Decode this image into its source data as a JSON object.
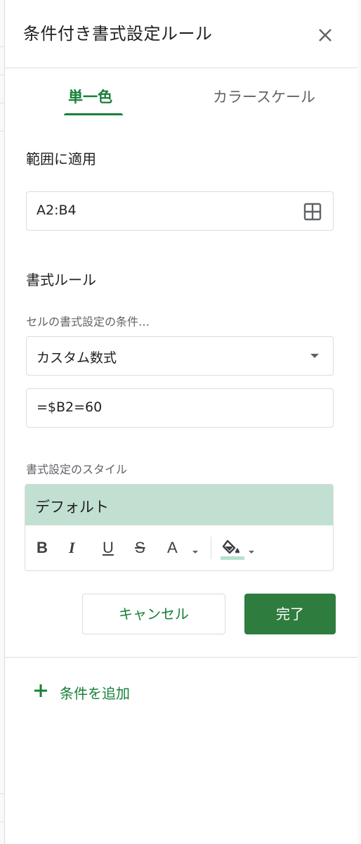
{
  "panel": {
    "title": "条件付き書式設定ルール",
    "close_icon": "close-icon"
  },
  "tabs": [
    {
      "label": "単一色",
      "active": true
    },
    {
      "label": "カラースケール",
      "active": false
    }
  ],
  "apply_range": {
    "label": "範囲に適用",
    "value": "A2:B4",
    "icon": "grid-select-icon"
  },
  "format_rules": {
    "label": "書式ルール",
    "condition_label": "セルの書式設定の条件…",
    "condition_value": "カスタム数式",
    "formula_value": "=$B2=60"
  },
  "style": {
    "label": "書式設定のスタイル",
    "preview_text": "デフォルト",
    "preview_color": "#c2e0d1",
    "toolbar": {
      "bold": "B",
      "italic": "I",
      "underline": "U",
      "strikethrough": "S",
      "text_color": "A",
      "fill_color": "#b7e1cd"
    }
  },
  "buttons": {
    "cancel": "キャンセル",
    "done": "完了"
  },
  "add_rule": {
    "label": "条件を追加"
  },
  "colors": {
    "accent": "#188038",
    "done_button": "#2f7c3f"
  }
}
